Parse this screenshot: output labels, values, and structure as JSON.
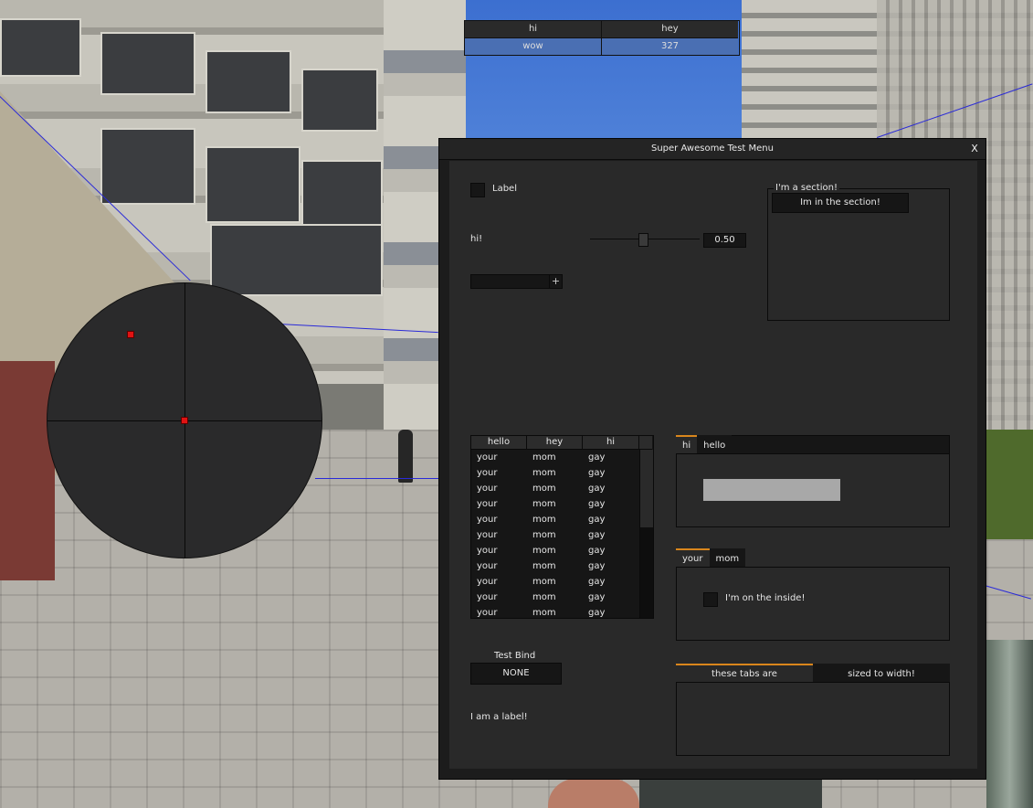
{
  "hud": {
    "table": {
      "headers": [
        "hi",
        "hey"
      ],
      "row": [
        "wow",
        "327"
      ]
    },
    "radar": {
      "blip_color": "#e01313"
    }
  },
  "window": {
    "title": "Super Awesome Test Menu",
    "close_label": "X",
    "checkbox_label": "Label",
    "slider": {
      "label": "hi!",
      "value": "0.50",
      "fraction": 0.5
    },
    "combo": {
      "plus_label": "+"
    },
    "section": {
      "title": "I'm a section!",
      "button_label": "Im in the section!"
    },
    "listview": {
      "columns": [
        "hello",
        "hey",
        "hi"
      ],
      "rows": [
        [
          "your",
          "mom",
          "gay"
        ],
        [
          "your",
          "mom",
          "gay"
        ],
        [
          "your",
          "mom",
          "gay"
        ],
        [
          "your",
          "mom",
          "gay"
        ],
        [
          "your",
          "mom",
          "gay"
        ],
        [
          "your",
          "mom",
          "gay"
        ],
        [
          "your",
          "mom",
          "gay"
        ],
        [
          "your",
          "mom",
          "gay"
        ],
        [
          "your",
          "mom",
          "gay"
        ],
        [
          "your",
          "mom",
          "gay"
        ],
        [
          "your",
          "mom",
          "gay"
        ]
      ]
    },
    "tabs1": {
      "tabs": [
        "hi",
        "hello"
      ],
      "active": 0
    },
    "tabs2": {
      "tabs": [
        "your",
        "mom"
      ],
      "active": 0,
      "inner_checkbox_label": "I'm on the inside!"
    },
    "tabs3": {
      "tabs": [
        "these tabs are",
        "sized to width!"
      ],
      "active": 0
    },
    "bind": {
      "label": "Test Bind",
      "value": "NONE"
    },
    "footer_label": "I am a label!",
    "accent_color": "#d9861c"
  }
}
